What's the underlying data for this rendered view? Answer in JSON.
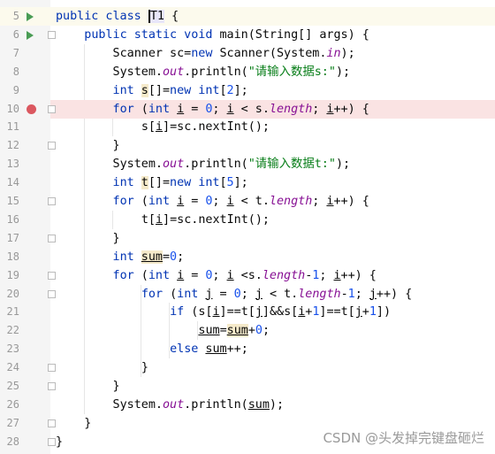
{
  "editor": {
    "lines": [
      {
        "num": "5",
        "run": true,
        "current": true,
        "indent": 0,
        "tokens": [
          [
            "k",
            "public class "
          ],
          [
            "cur",
            "T1"
          ],
          [
            "p",
            " {"
          ]
        ]
      },
      {
        "num": "6",
        "run": true,
        "fold": true,
        "indent": 1,
        "tokens": [
          [
            "k",
            "public static void "
          ],
          [
            "p",
            "main(String[] args) {"
          ]
        ]
      },
      {
        "num": "7",
        "indent": 2,
        "tokens": [
          [
            "p",
            "Scanner sc="
          ],
          [
            "k",
            "new"
          ],
          [
            "p",
            " Scanner(System."
          ],
          [
            "f",
            "in"
          ],
          [
            "p",
            ");"
          ]
        ]
      },
      {
        "num": "8",
        "indent": 2,
        "tokens": [
          [
            "p",
            "System."
          ],
          [
            "f",
            "out"
          ],
          [
            "p",
            ".println("
          ],
          [
            "s",
            "\"请输入数据s:\""
          ],
          [
            "p",
            ");"
          ]
        ]
      },
      {
        "num": "9",
        "indent": 2,
        "tokens": [
          [
            "k",
            "int "
          ],
          [
            "h",
            "s"
          ],
          [
            "p",
            "[]="
          ],
          [
            "k",
            "new int"
          ],
          [
            "p",
            "["
          ],
          [
            "n",
            "2"
          ],
          [
            "p",
            "];"
          ]
        ]
      },
      {
        "num": "10",
        "breakpoint": true,
        "fold": true,
        "indent": 2,
        "tokens": [
          [
            "k",
            "for "
          ],
          [
            "p",
            "("
          ],
          [
            "k",
            "int "
          ],
          [
            "u",
            "i"
          ],
          [
            "p",
            " = "
          ],
          [
            "n",
            "0"
          ],
          [
            "p",
            "; "
          ],
          [
            "u",
            "i"
          ],
          [
            "p",
            " < s."
          ],
          [
            "f",
            "length"
          ],
          [
            "p",
            "; "
          ],
          [
            "u",
            "i"
          ],
          [
            "p",
            "++) {"
          ]
        ]
      },
      {
        "num": "11",
        "indent": 3,
        "tokens": [
          [
            "p",
            "s["
          ],
          [
            "u",
            "i"
          ],
          [
            "p",
            "]=sc.nextInt();"
          ]
        ]
      },
      {
        "num": "12",
        "fold": true,
        "indent": 2,
        "tokens": [
          [
            "p",
            "}"
          ]
        ]
      },
      {
        "num": "13",
        "indent": 2,
        "tokens": [
          [
            "p",
            "System."
          ],
          [
            "f",
            "out"
          ],
          [
            "p",
            ".println("
          ],
          [
            "s",
            "\"请输入数据t:\""
          ],
          [
            "p",
            ");"
          ]
        ]
      },
      {
        "num": "14",
        "indent": 2,
        "tokens": [
          [
            "k",
            "int "
          ],
          [
            "h",
            "t"
          ],
          [
            "p",
            "[]="
          ],
          [
            "k",
            "new int"
          ],
          [
            "p",
            "["
          ],
          [
            "n",
            "5"
          ],
          [
            "p",
            "];"
          ]
        ]
      },
      {
        "num": "15",
        "fold": true,
        "indent": 2,
        "tokens": [
          [
            "k",
            "for "
          ],
          [
            "p",
            "("
          ],
          [
            "k",
            "int "
          ],
          [
            "u",
            "i"
          ],
          [
            "p",
            " = "
          ],
          [
            "n",
            "0"
          ],
          [
            "p",
            "; "
          ],
          [
            "u",
            "i"
          ],
          [
            "p",
            " < t."
          ],
          [
            "f",
            "length"
          ],
          [
            "p",
            "; "
          ],
          [
            "u",
            "i"
          ],
          [
            "p",
            "++) {"
          ]
        ]
      },
      {
        "num": "16",
        "indent": 3,
        "tokens": [
          [
            "p",
            "t["
          ],
          [
            "u",
            "i"
          ],
          [
            "p",
            "]=sc.nextInt();"
          ]
        ]
      },
      {
        "num": "17",
        "fold": true,
        "indent": 2,
        "tokens": [
          [
            "p",
            "}"
          ]
        ]
      },
      {
        "num": "18",
        "indent": 2,
        "tokens": [
          [
            "k",
            "int "
          ],
          [
            "hu",
            "sum"
          ],
          [
            "p",
            "="
          ],
          [
            "n",
            "0"
          ],
          [
            "p",
            ";"
          ]
        ]
      },
      {
        "num": "19",
        "fold": true,
        "indent": 2,
        "tokens": [
          [
            "k",
            "for "
          ],
          [
            "p",
            "("
          ],
          [
            "k",
            "int "
          ],
          [
            "u",
            "i"
          ],
          [
            "p",
            " = "
          ],
          [
            "n",
            "0"
          ],
          [
            "p",
            "; "
          ],
          [
            "u",
            "i"
          ],
          [
            "p",
            " <s."
          ],
          [
            "f",
            "length"
          ],
          [
            "p",
            "-"
          ],
          [
            "n",
            "1"
          ],
          [
            "p",
            "; "
          ],
          [
            "u",
            "i"
          ],
          [
            "p",
            "++) {"
          ]
        ]
      },
      {
        "num": "20",
        "fold": true,
        "indent": 3,
        "tokens": [
          [
            "k",
            "for "
          ],
          [
            "p",
            "("
          ],
          [
            "k",
            "int "
          ],
          [
            "u",
            "j"
          ],
          [
            "p",
            " = "
          ],
          [
            "n",
            "0"
          ],
          [
            "p",
            "; "
          ],
          [
            "u",
            "j"
          ],
          [
            "p",
            " < t."
          ],
          [
            "f",
            "length"
          ],
          [
            "p",
            "-"
          ],
          [
            "n",
            "1"
          ],
          [
            "p",
            "; "
          ],
          [
            "u",
            "j"
          ],
          [
            "p",
            "++) {"
          ]
        ]
      },
      {
        "num": "21",
        "indent": 4,
        "tokens": [
          [
            "k",
            "if "
          ],
          [
            "p",
            "(s["
          ],
          [
            "u",
            "i"
          ],
          [
            "p",
            "]==t["
          ],
          [
            "u",
            "j"
          ],
          [
            "p",
            "]&&s["
          ],
          [
            "u",
            "i"
          ],
          [
            "p",
            "+"
          ],
          [
            "n",
            "1"
          ],
          [
            "p",
            "]==t["
          ],
          [
            "u",
            "j"
          ],
          [
            "p",
            "+"
          ],
          [
            "n",
            "1"
          ],
          [
            "p",
            "])"
          ]
        ]
      },
      {
        "num": "22",
        "indent": 5,
        "tokens": [
          [
            "u",
            "sum"
          ],
          [
            "p",
            "="
          ],
          [
            "hu",
            "sum"
          ],
          [
            "p",
            "+"
          ],
          [
            "n",
            "0"
          ],
          [
            "p",
            ";"
          ]
        ]
      },
      {
        "num": "23",
        "indent": 4,
        "tokens": [
          [
            "k",
            "else "
          ],
          [
            "u",
            "sum"
          ],
          [
            "p",
            "++;"
          ]
        ]
      },
      {
        "num": "24",
        "fold": true,
        "indent": 3,
        "tokens": [
          [
            "p",
            "}"
          ]
        ]
      },
      {
        "num": "25",
        "fold": true,
        "indent": 2,
        "tokens": [
          [
            "p",
            "}"
          ]
        ]
      },
      {
        "num": "26",
        "indent": 2,
        "tokens": [
          [
            "p",
            "System."
          ],
          [
            "f",
            "out"
          ],
          [
            "p",
            ".println("
          ],
          [
            "u",
            "sum"
          ],
          [
            "p",
            ");"
          ]
        ]
      },
      {
        "num": "27",
        "fold": true,
        "indent": 1,
        "tokens": [
          [
            "p",
            "}"
          ]
        ]
      },
      {
        "num": "28",
        "fold": true,
        "indent": 0,
        "tokens": [
          [
            "p",
            "}"
          ]
        ]
      }
    ]
  },
  "colors": {
    "keyword": "#0033b3",
    "number": "#1750eb",
    "field": "#871094",
    "string": "#067d17",
    "breakpoint": "#db5860",
    "run": "#499c54"
  },
  "watermark": "CSDN @头发掉完键盘砸烂"
}
